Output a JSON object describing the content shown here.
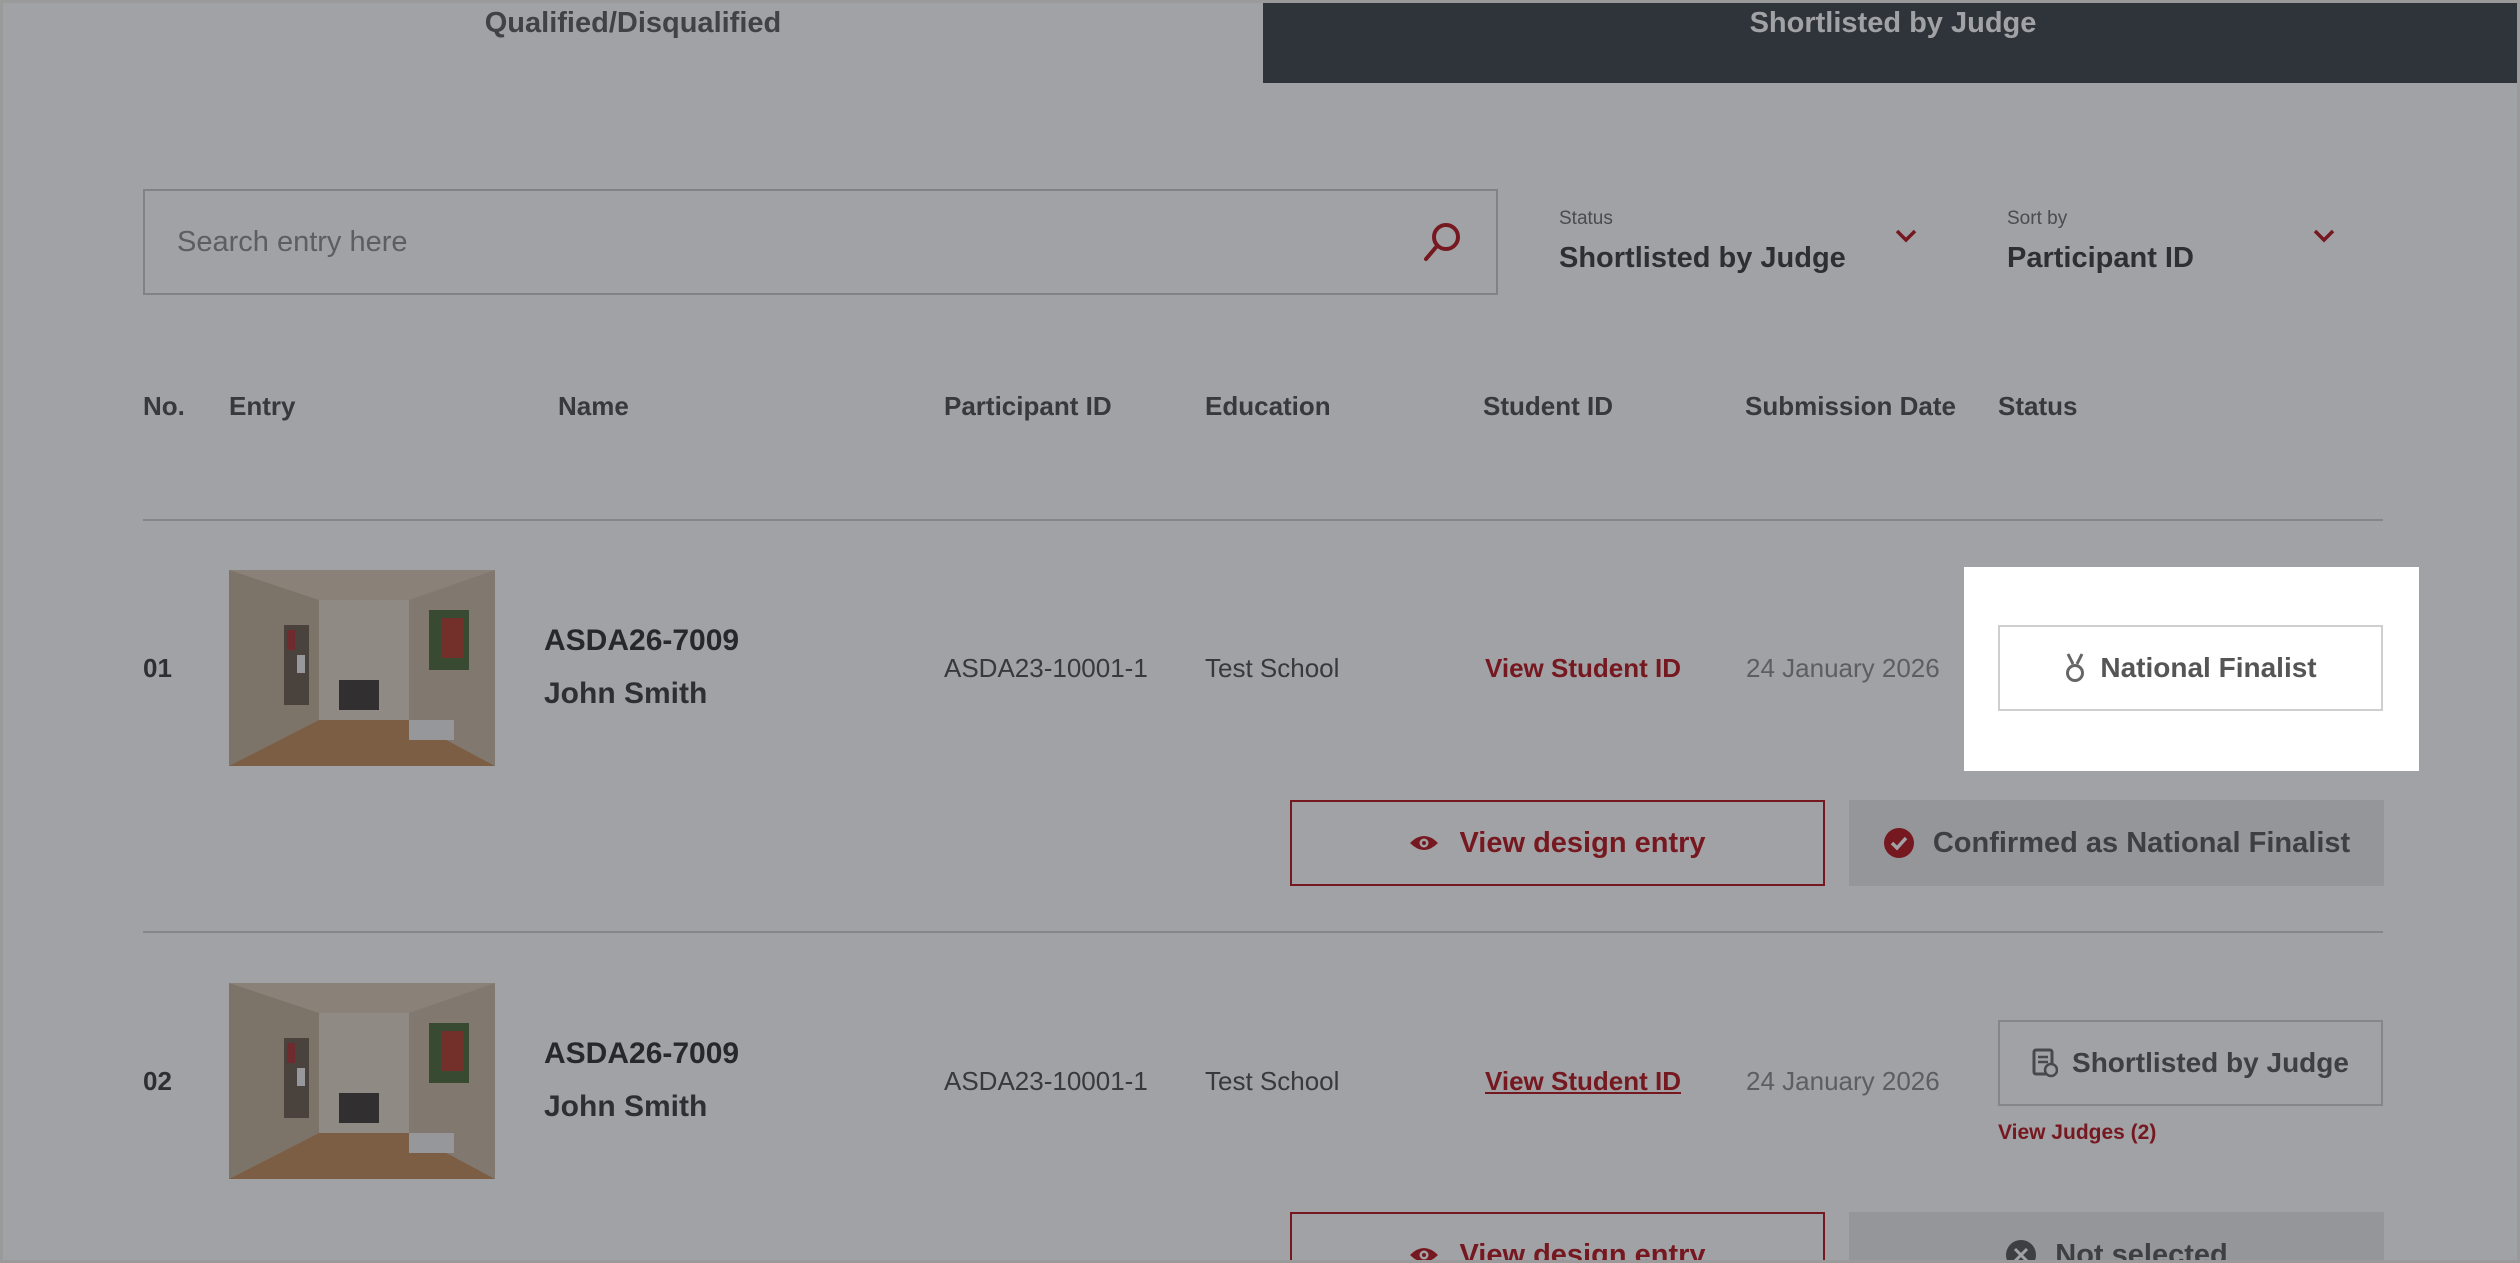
{
  "tabs": [
    {
      "label": "Qualified/Disqualified",
      "active": false
    },
    {
      "label": "Shortlisted by Judge",
      "active": true
    }
  ],
  "search": {
    "placeholder": "Search entry here",
    "value": "",
    "icon": "search-icon"
  },
  "filters": {
    "status": {
      "label": "Status",
      "value": "Shortlisted by Judge"
    },
    "sort": {
      "label": "Sort by",
      "value": "Participant ID"
    }
  },
  "table": {
    "headers": [
      "No.",
      "Entry",
      "Name",
      "Participant ID",
      "Education",
      "Student ID",
      "Submission Date",
      "Status"
    ],
    "rows": [
      {
        "no": "01",
        "entry_id": "ASDA26-7009",
        "name": "John Smith",
        "participant_id": "ASDA23-10001-1",
        "education": "Test School",
        "student_id_link": "View Student ID",
        "submission_date": "24 January 2026",
        "status": "National Finalist",
        "status_icon": "medal-icon",
        "design_button": "View design entry",
        "action_button": "Confirmed as National Finalist",
        "action_icon": "check-circle-icon"
      },
      {
        "no": "02",
        "entry_id": "ASDA26-7009",
        "name": "John Smith",
        "participant_id": "ASDA23-10001-1",
        "education": "Test School",
        "student_id_link": "View Student ID",
        "submission_date": "24 January 2026",
        "status": "Shortlisted by Judge",
        "status_icon": "clipboard-icon",
        "view_judges": "View Judges (2)",
        "design_button": "View design entry",
        "action_button": "Not selected",
        "action_icon": "x-circle-icon"
      }
    ]
  },
  "colors": {
    "accent": "#b5121b",
    "tab_active_bg": "#3c4047",
    "overlay": "#1e2128"
  }
}
